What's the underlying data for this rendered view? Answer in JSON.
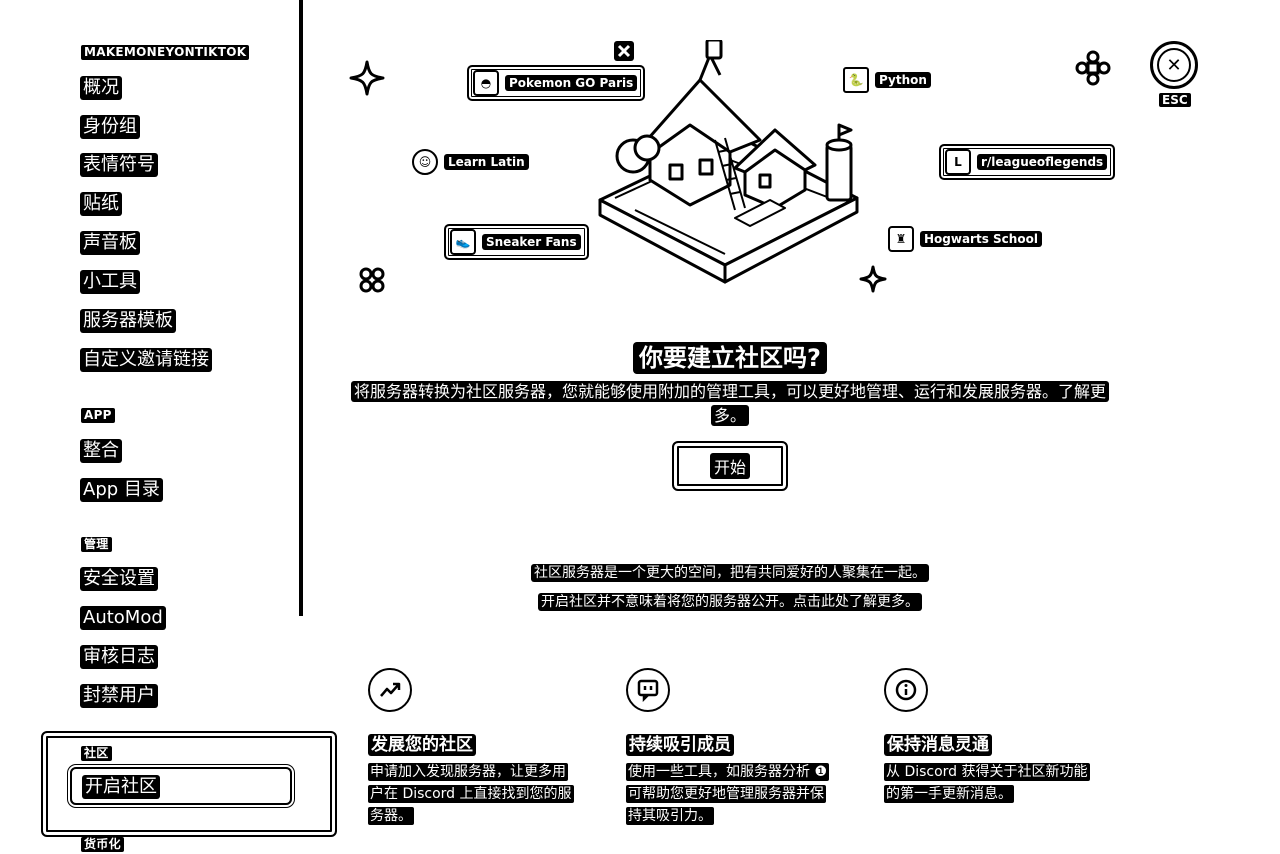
{
  "sidebar": {
    "server_name": "MAKEMONEYONTIKTOK",
    "items": [
      "概况",
      "身份组",
      "表情符号",
      "贴纸",
      "声音板",
      "小工具",
      "服务器模板",
      "自定义邀请链接"
    ],
    "app_header": "APP",
    "app_items": [
      "整合",
      "App 目录"
    ],
    "manage_header": "管理",
    "manage_items": [
      "安全设置",
      "AutoMod",
      "审核日志",
      "封禁用户"
    ],
    "community_header": "社区",
    "community_active": "开启社区",
    "monetization_header": "货币化"
  },
  "close": {
    "label": "ESC"
  },
  "hero": {
    "pills": {
      "pokemon": "Pokemon GO Paris",
      "python": "Python",
      "latin": "Learn Latin",
      "league": "r/leagueoflegends",
      "sneaker": "Sneaker Fans",
      "hogwarts": "Hogwarts School"
    },
    "title": "你要建立社区吗?",
    "description": "将服务器转换为社区服务器，您就能够使用附加的管理工具，可以更好地管理、运行和发展服务器。了解更多。",
    "start_button": "开始"
  },
  "info": {
    "line1": "社区服务器是一个更大的空间，把有共同爱好的人聚集在一起。",
    "line2": "开启社区并不意味着将您的服务器公开。点击此处了解更多。"
  },
  "features": [
    {
      "icon": "growth-chart-icon",
      "title": "发展您的社区",
      "desc": "申请加入发现服务器，让更多用户在 Discord 上直接找到您的服务器。"
    },
    {
      "icon": "chat-bubble-icon",
      "title": "持续吸引成员",
      "desc": "使用一些工具，如服务器分析 ❶ 可帮助您更好地管理服务器并保持其吸引力。"
    },
    {
      "icon": "info-icon",
      "title": "保持消息灵通",
      "desc": "从 Discord 获得关于社区新功能的第一手更新消息。"
    }
  ]
}
